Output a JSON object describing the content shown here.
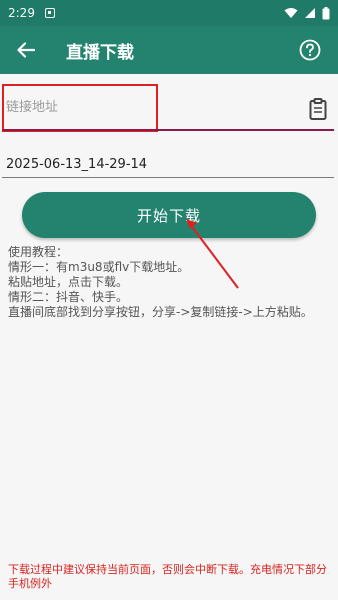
{
  "status_bar": {
    "time": "2:29",
    "icons": [
      "notification-icon",
      "wifi-icon",
      "signal-icon",
      "battery-icon"
    ]
  },
  "app_bar": {
    "title": "直播下载",
    "back_icon": "arrow-left-icon",
    "help_icon": "help-circle-icon"
  },
  "form": {
    "url_placeholder": "链接地址",
    "clipboard_icon": "clipboard-icon",
    "filename_value": "2025-06-13_14-29-14"
  },
  "start_button": {
    "label": "开始下载"
  },
  "tutorial": {
    "lines": [
      "使用教程：",
      "情形一：有m3u8或flv下载地址。",
      "粘贴地址，点击下载。",
      "情形二：抖音、快手。",
      "直播间底部找到分享按钮，分享->复制链接->上方粘贴。"
    ]
  },
  "warning": "下载过程中建议保持当前页面，否则会中断下载。充电情况下部分手机例外",
  "colors": {
    "primary": "#24836f",
    "status_bar": "#1f7a67",
    "underline_active": "#8a1b4a",
    "warning": "#d8241f",
    "annotation": "#e02020"
  }
}
